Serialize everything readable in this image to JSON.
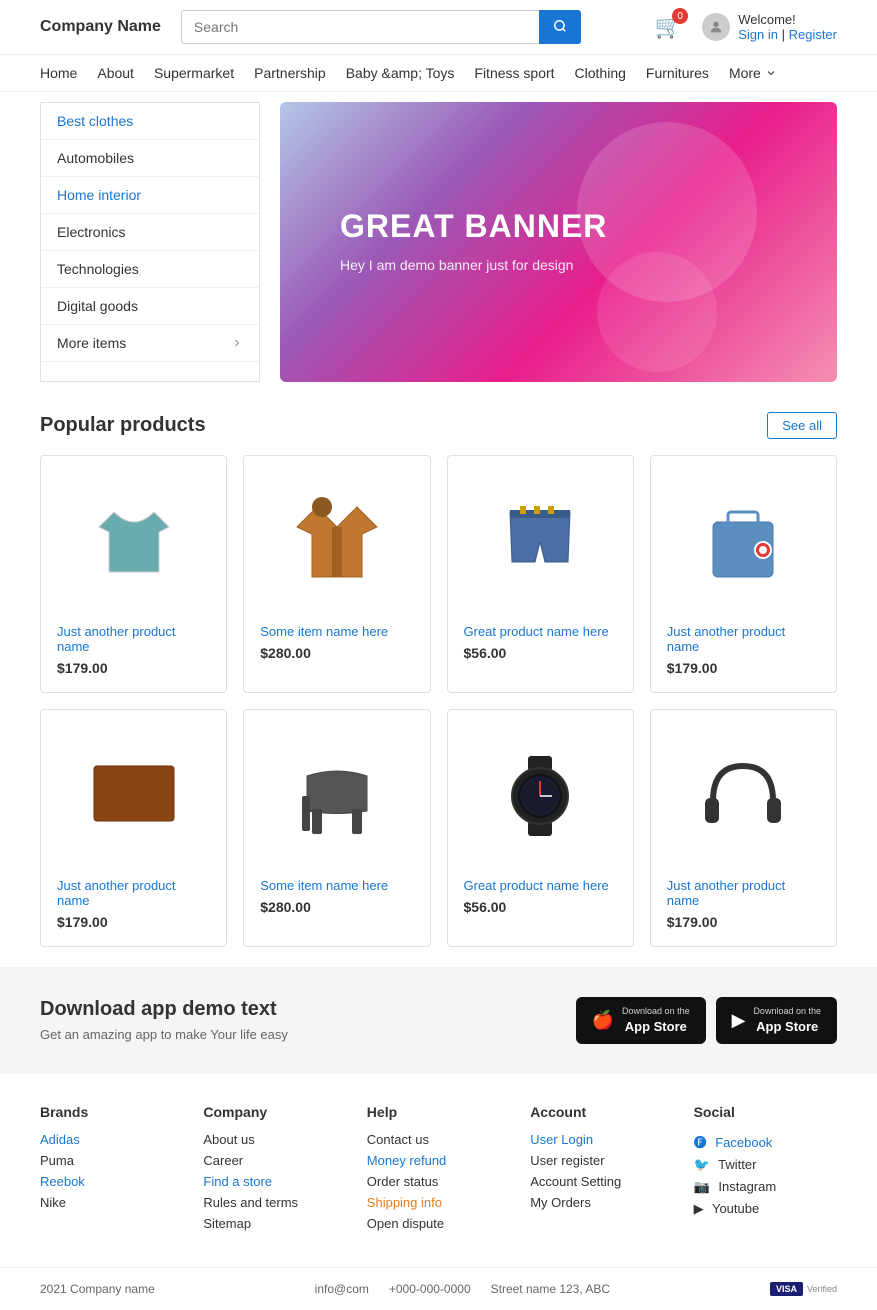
{
  "header": {
    "logo": "Company Name",
    "search_placeholder": "Search",
    "cart_badge": "0",
    "welcome_greeting": "Welcome!",
    "sign_in": "Sign in",
    "divider": "|",
    "register": "Register"
  },
  "nav": {
    "items": [
      {
        "label": "Home",
        "href": "#"
      },
      {
        "label": "About",
        "href": "#"
      },
      {
        "label": "Supermarket",
        "href": "#"
      },
      {
        "label": "Partnership",
        "href": "#"
      },
      {
        "label": "Baby &amp; Toys",
        "href": "#"
      },
      {
        "label": "Fitness sport",
        "href": "#"
      },
      {
        "label": "Clothing",
        "href": "#"
      },
      {
        "label": "Furnitures",
        "href": "#"
      },
      {
        "label": "More",
        "href": "#"
      }
    ]
  },
  "sidebar": {
    "items": [
      {
        "label": "Best clothes",
        "active": true
      },
      {
        "label": "Automobiles",
        "active": false
      },
      {
        "label": "Home interior",
        "active": false
      },
      {
        "label": "Electronics",
        "active": false
      },
      {
        "label": "Technologies",
        "active": false
      },
      {
        "label": "Digital goods",
        "active": false
      },
      {
        "label": "More items",
        "has_arrow": true
      }
    ]
  },
  "banner": {
    "title": "GREAT BANNER",
    "subtitle": "Hey I am demo banner just for design"
  },
  "products": {
    "section_title": "Popular products",
    "see_all_label": "See all",
    "items": [
      {
        "name": "Just another product name",
        "price": "$179.00",
        "color": "#6aabb0",
        "type": "shirt"
      },
      {
        "name": "Some item name here",
        "price": "$280.00",
        "color": "#c07830",
        "type": "jacket"
      },
      {
        "name": "Great product name here",
        "price": "$56.00",
        "color": "#4a6fa5",
        "type": "shorts"
      },
      {
        "name": "Just another product name",
        "price": "$179.00",
        "color": "#5a8fc0",
        "type": "bag"
      },
      {
        "name": "Just another product name",
        "price": "$179.00",
        "color": "#b56a30",
        "type": "laptop"
      },
      {
        "name": "Some item name here",
        "price": "$280.00",
        "color": "#555",
        "type": "chair"
      },
      {
        "name": "Great product name here",
        "price": "$56.00",
        "color": "#222",
        "type": "watch"
      },
      {
        "name": "Just another product name",
        "price": "$179.00",
        "color": "#333",
        "type": "headphones"
      }
    ]
  },
  "download": {
    "title": "Download app demo text",
    "subtitle": "Get an amazing app to make Your life easy",
    "appstore_sub": "Download on the",
    "appstore_main": "App Store",
    "googleplay_sub": "Download on the",
    "googleplay_main": "App Store"
  },
  "footer": {
    "brands": {
      "title": "Brands",
      "items": [
        {
          "label": "Adidas",
          "color": "blue"
        },
        {
          "label": "Puma",
          "color": "normal"
        },
        {
          "label": "Reebok",
          "color": "blue"
        },
        {
          "label": "Nike",
          "color": "normal"
        }
      ]
    },
    "company": {
      "title": "Company",
      "items": [
        {
          "label": "About us",
          "color": "normal"
        },
        {
          "label": "Career",
          "color": "normal"
        },
        {
          "label": "Find a store",
          "color": "blue"
        },
        {
          "label": "Rules and terms",
          "color": "normal"
        },
        {
          "label": "Sitemap",
          "color": "normal"
        }
      ]
    },
    "help": {
      "title": "Help",
      "items": [
        {
          "label": "Contact us",
          "color": "normal"
        },
        {
          "label": "Money refund",
          "color": "blue"
        },
        {
          "label": "Order status",
          "color": "normal"
        },
        {
          "label": "Shipping info",
          "color": "orange"
        },
        {
          "label": "Open dispute",
          "color": "normal"
        }
      ]
    },
    "account": {
      "title": "Account",
      "items": [
        {
          "label": "User Login",
          "color": "blue"
        },
        {
          "label": "User register",
          "color": "normal"
        },
        {
          "label": "Account Setting",
          "color": "normal"
        },
        {
          "label": "My Orders",
          "color": "normal"
        }
      ]
    },
    "social": {
      "title": "Social",
      "items": [
        {
          "label": "Facebook",
          "icon": "f",
          "color": "blue"
        },
        {
          "label": "Twitter",
          "icon": "t",
          "color": "normal"
        },
        {
          "label": "Instagram",
          "icon": "i",
          "color": "normal"
        },
        {
          "label": "Youtube",
          "icon": "y",
          "color": "normal"
        }
      ]
    }
  },
  "footer_bottom": {
    "copyright": "2021 Company name",
    "email": "info@com",
    "phone": "+000-000-0000",
    "address": "Street name 123, ABC"
  }
}
